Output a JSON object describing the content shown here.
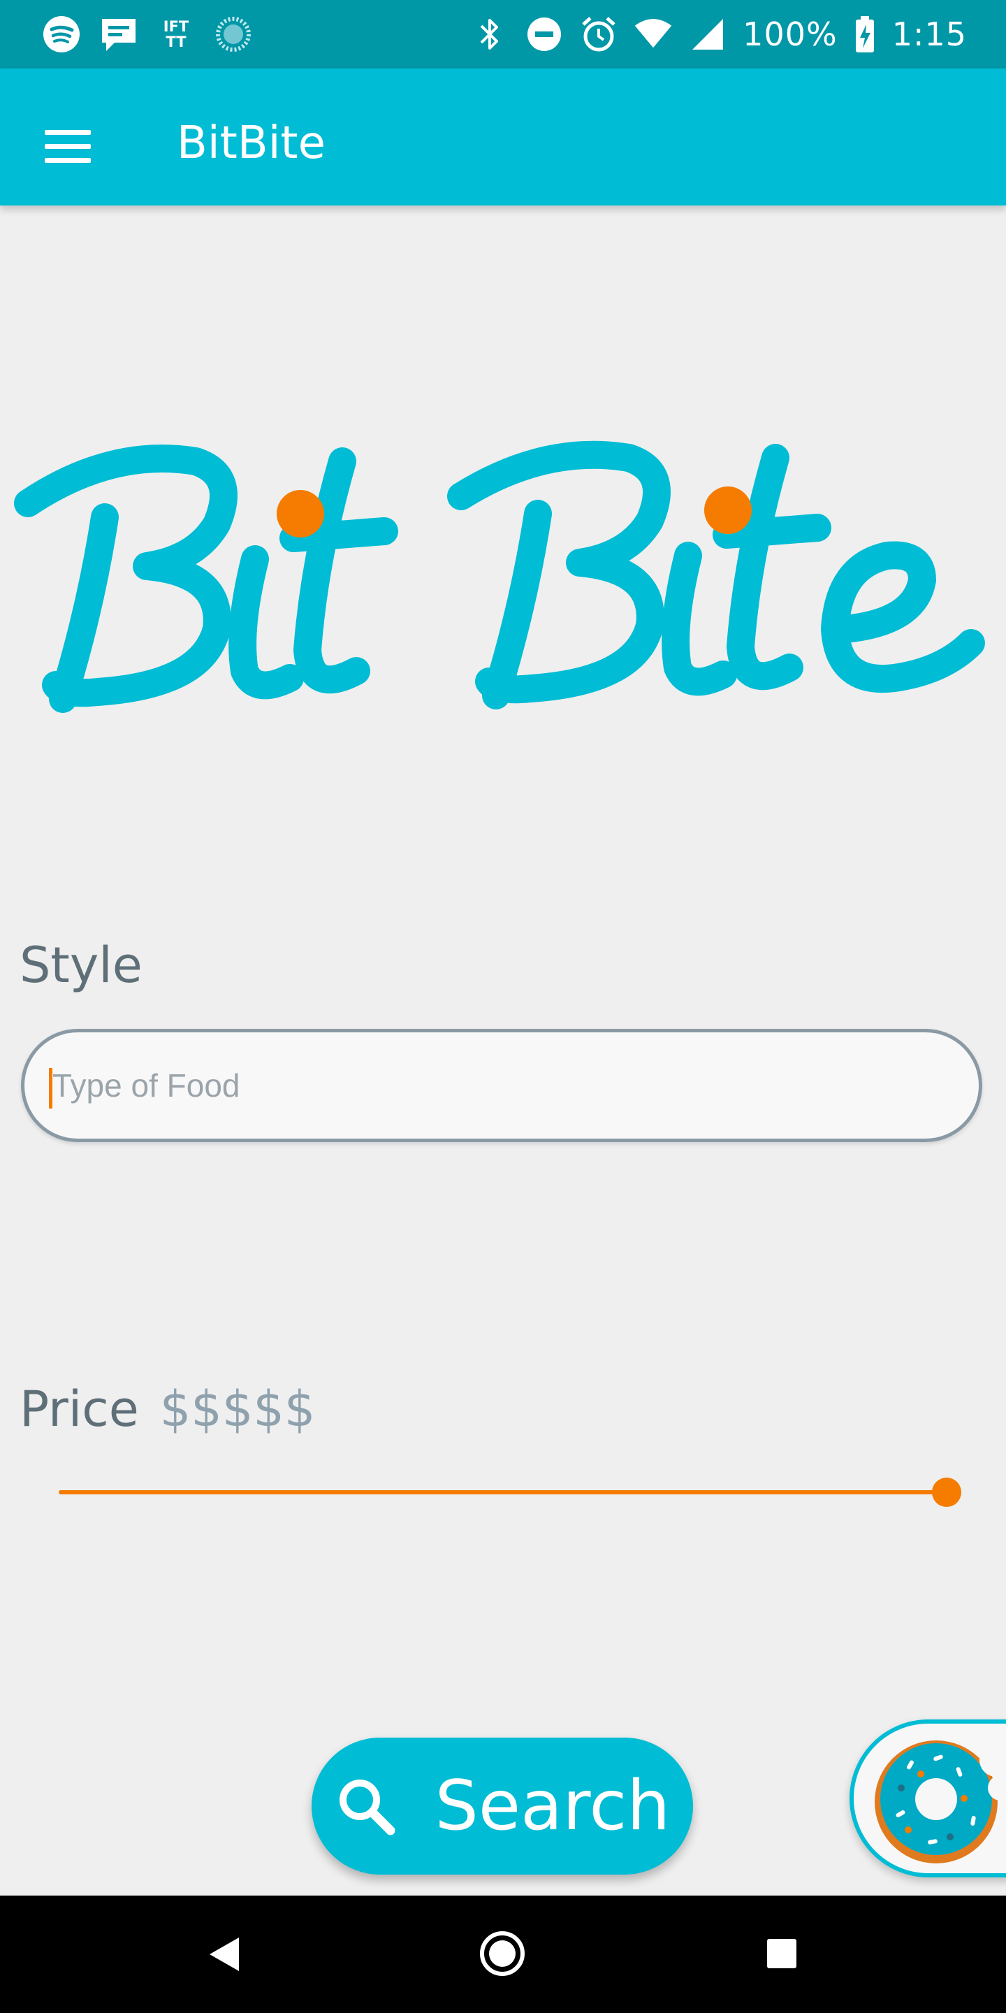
{
  "status_bar": {
    "notification_icons": [
      "spotify-icon",
      "messages-icon",
      "ifttt-icon",
      "loading-icon"
    ],
    "ifttt_text": "IFTTT",
    "system_icons": [
      "bluetooth-icon",
      "do-not-disturb-icon",
      "alarm-icon",
      "wifi-icon",
      "cellular-icon"
    ],
    "battery": "100%",
    "time": "1:15"
  },
  "app_bar": {
    "title": "BitBite",
    "menu_icon": "hamburger-menu-icon"
  },
  "logo": {
    "text": "BitBite",
    "primary_color": "#00bcd4",
    "accent_color": "#f57c00"
  },
  "style_field": {
    "label": "Style",
    "placeholder": "Type of Food",
    "value": ""
  },
  "price": {
    "label": "Price",
    "value": "$$$$$",
    "slider_fraction": 1.0
  },
  "search_button": {
    "label": "Search",
    "icon": "search-icon"
  },
  "donut_button": {
    "icon": "donut-icon"
  },
  "nav_bar": {
    "icons": [
      "back-icon",
      "home-icon",
      "recents-icon"
    ]
  },
  "colors": {
    "status_bar": "#0097a7",
    "app_bar": "#00bcd4",
    "accent": "#f57c00",
    "background": "#efefef"
  }
}
